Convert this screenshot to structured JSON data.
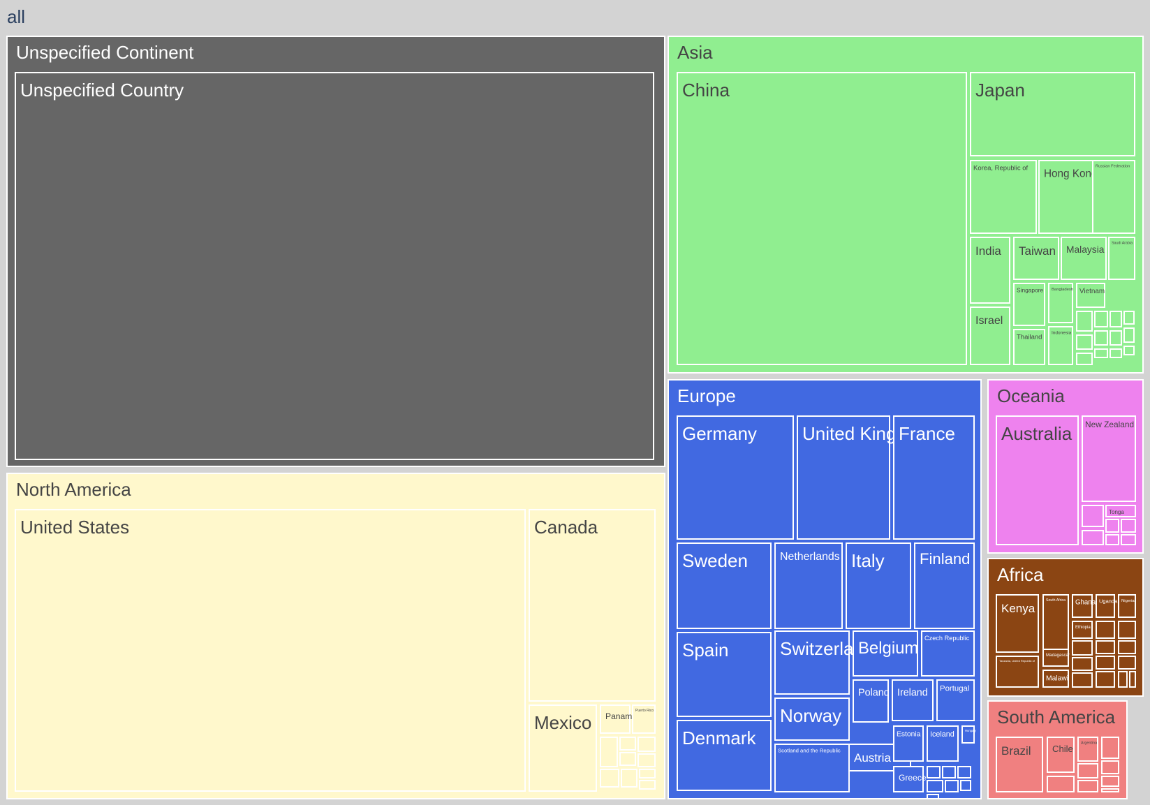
{
  "chart_data": {
    "type": "treemap",
    "title": "",
    "root": {
      "label": "all",
      "children": [
        {
          "label": "Unspecified Continent",
          "color": "#666666",
          "children": [
            {
              "label": "Unspecified Country",
              "value": 1036
            }
          ]
        },
        {
          "label": "North America",
          "color": "#FFF8CC",
          "children": [
            {
              "label": "United States",
              "value": 603
            },
            {
              "label": "Canada",
              "value": 120
            },
            {
              "label": "Mexico",
              "value": 20
            },
            {
              "label": "Panama",
              "value": 4
            },
            {
              "label": "Puerto Rico",
              "value": 4
            },
            {
              "label": "",
              "value": 3
            },
            {
              "label": "",
              "value": 2
            },
            {
              "label": "",
              "value": 2
            },
            {
              "label": "",
              "value": 1.5
            },
            {
              "label": "",
              "value": 1.5
            },
            {
              "label": "",
              "value": 1
            },
            {
              "label": "",
              "value": 1
            },
            {
              "label": "",
              "value": 0.7
            },
            {
              "label": "",
              "value": 0.7
            }
          ]
        },
        {
          "label": "Asia",
          "color": "#90EE90",
          "children": [
            {
              "label": "China",
              "value": 344
            },
            {
              "label": "Japan",
              "value": 81
            },
            {
              "label": "Korea, Republic of",
              "value": 35
            },
            {
              "label": "Hong Kong",
              "value": 25
            },
            {
              "label": "Russian Federation",
              "value": 20
            },
            {
              "label": "India",
              "value": 18
            },
            {
              "label": "Taiwan",
              "value": 12
            },
            {
              "label": "Malaysia",
              "value": 9
            },
            {
              "label": "Saudi Arabia",
              "value": 8
            },
            {
              "label": "Israel",
              "value": 16
            },
            {
              "label": "Singapore",
              "value": 8
            },
            {
              "label": "Bangladesh",
              "value": 5
            },
            {
              "label": "Vietnam",
              "value": 5
            },
            {
              "label": "Thailand",
              "value": 6
            },
            {
              "label": "Indonesia",
              "value": 5
            },
            {
              "label": "",
              "value": 2
            },
            {
              "label": "",
              "value": 2
            },
            {
              "label": "",
              "value": 1.5
            },
            {
              "label": "",
              "value": 1.5
            },
            {
              "label": "",
              "value": 1.5
            },
            {
              "label": "",
              "value": 1
            },
            {
              "label": "",
              "value": 1
            },
            {
              "label": "",
              "value": 1
            },
            {
              "label": "",
              "value": 0.8
            },
            {
              "label": "",
              "value": 0.8
            },
            {
              "label": "",
              "value": 0.6
            },
            {
              "label": "",
              "value": 0.6
            }
          ]
        },
        {
          "label": "Europe",
          "color": "#4169E1",
          "children": [
            {
              "label": "Germany",
              "value": 62
            },
            {
              "label": "United Kingdom",
              "value": 48
            },
            {
              "label": "France",
              "value": 42
            },
            {
              "label": "Sweden",
              "value": 28
            },
            {
              "label": "Netherlands",
              "value": 25
            },
            {
              "label": "Italy",
              "value": 22
            },
            {
              "label": "Finland",
              "value": 21
            },
            {
              "label": "Spain",
              "value": 25
            },
            {
              "label": "Switzerland",
              "value": 20
            },
            {
              "label": "Belgium",
              "value": 13
            },
            {
              "label": "Czech Republic",
              "value": 12
            },
            {
              "label": "Denmark",
              "value": 22
            },
            {
              "label": "Norway",
              "value": 11
            },
            {
              "label": "Austria",
              "value": 12
            },
            {
              "label": "Scotland and the Republic",
              "value": 7
            },
            {
              "label": "Ireland",
              "value": 6
            },
            {
              "label": "Portugal",
              "value": 6
            },
            {
              "label": "Poland",
              "value": 6
            },
            {
              "label": "Estonia",
              "value": 4
            },
            {
              "label": "Iceland",
              "value": 4
            },
            {
              "label": "Hungary",
              "value": 3
            },
            {
              "label": "Greece",
              "value": 3
            },
            {
              "label": "",
              "value": 1.5
            },
            {
              "label": "",
              "value": 1.5
            },
            {
              "label": "",
              "value": 1.2
            },
            {
              "label": "",
              "value": 1
            },
            {
              "label": "",
              "value": 1
            },
            {
              "label": "",
              "value": 0.8
            },
            {
              "label": "",
              "value": 0.8
            }
          ]
        },
        {
          "label": "Oceania",
          "color": "#EE82EE",
          "children": [
            {
              "label": "Australia",
              "value": 75
            },
            {
              "label": "New Zealand",
              "value": 40
            },
            {
              "label": "",
              "value": 2
            },
            {
              "label": "Tonga",
              "value": 2
            },
            {
              "label": "",
              "value": 1
            },
            {
              "label": "",
              "value": 1
            },
            {
              "label": "",
              "value": 1
            },
            {
              "label": "",
              "value": 0.8
            },
            {
              "label": "",
              "value": 0.8
            }
          ]
        },
        {
          "label": "Africa",
          "color": "#8B4513",
          "children": [
            {
              "label": "Kenya",
              "value": 22
            },
            {
              "label": "South Africa",
              "value": 14
            },
            {
              "label": "Ghana",
              "value": 6
            },
            {
              "label": "Uganda",
              "value": 5
            },
            {
              "label": "Nigeria",
              "value": 5
            },
            {
              "label": "Ethiopia",
              "value": 3
            },
            {
              "label": "Madagascar",
              "value": 4
            },
            {
              "label": "Tanzania, United Republic of",
              "value": 10
            },
            {
              "label": "Malawi",
              "value": 4
            },
            {
              "label": "",
              "value": 2
            },
            {
              "label": "",
              "value": 2
            },
            {
              "label": "",
              "value": 2
            },
            {
              "label": "",
              "value": 1.5
            },
            {
              "label": "",
              "value": 1.5
            },
            {
              "label": "",
              "value": 1.5
            },
            {
              "label": "",
              "value": 1
            },
            {
              "label": "",
              "value": 1
            },
            {
              "label": "",
              "value": 1
            },
            {
              "label": "",
              "value": 0.8
            },
            {
              "label": "",
              "value": 0.8
            },
            {
              "label": "",
              "value": 0.6
            }
          ]
        },
        {
          "label": "South America",
          "color": "#F08080",
          "children": [
            {
              "label": "Brazil",
              "value": 22
            },
            {
              "label": "Chile",
              "value": 12
            },
            {
              "label": "Argentina",
              "value": 7
            },
            {
              "label": "",
              "value": 4
            },
            {
              "label": "",
              "value": 3
            },
            {
              "label": "",
              "value": 2
            },
            {
              "label": "",
              "value": 1.5
            },
            {
              "label": "",
              "value": 1
            },
            {
              "label": "",
              "value": 1
            },
            {
              "label": "",
              "value": 0.8
            }
          ]
        }
      ]
    },
    "colors": {
      "pathbar": "#D3D3D3",
      "border": "#ffffff",
      "background": "#ffffff",
      "label_dark": "#444444",
      "label_light": "#ffffff",
      "root_label": "#2A3F5F"
    }
  }
}
